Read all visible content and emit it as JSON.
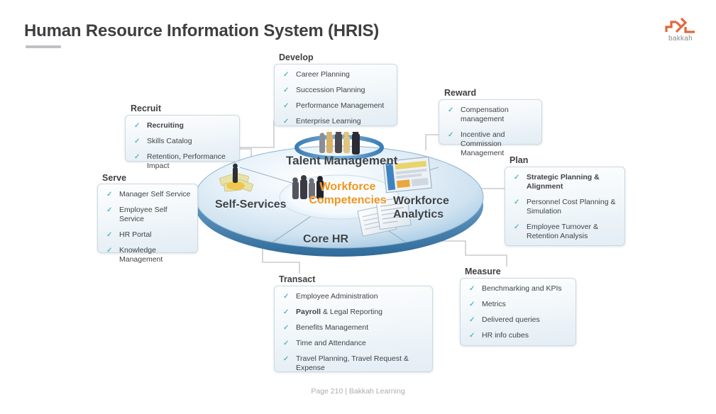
{
  "header": {
    "title": "Human Resource Information System (HRIS)"
  },
  "logo": {
    "wordmark": "bakkah",
    "icon": "bakkah-logo-icon",
    "color": "#e2683c"
  },
  "boxes": [
    {
      "id": "develop",
      "title": "Develop",
      "items": [
        {
          "text": "Career Planning",
          "bold": false
        },
        {
          "text": "Succession Planning",
          "bold": false
        },
        {
          "text": "Performance Management",
          "bold": false
        },
        {
          "text": "Enterprise Learning",
          "bold": false
        }
      ]
    },
    {
      "id": "recruit",
      "title": "Recruit",
      "items": [
        {
          "text": "Recruiting",
          "bold": true
        },
        {
          "text": "Skills Catalog",
          "bold": false
        },
        {
          "text": "Retention, Performance Impact",
          "bold": false
        }
      ]
    },
    {
      "id": "reward",
      "title": "Reward",
      "items": [
        {
          "text": "Compensation management",
          "bold": false
        },
        {
          "text": "Incentive and Commission Management",
          "bold": false
        }
      ]
    },
    {
      "id": "serve",
      "title": "Serve",
      "items": [
        {
          "text": "Manager Self Service",
          "bold": false
        },
        {
          "text": "Employee Self Service",
          "bold": false
        },
        {
          "text": "HR Portal",
          "bold": false
        },
        {
          "text": "Knowledge Management",
          "bold": false
        }
      ]
    },
    {
      "id": "plan",
      "title": "Plan",
      "items": [
        {
          "text": "Strategic Planning & Alignment",
          "bold": true
        },
        {
          "text": "Personnel Cost Planning & Simulation",
          "bold": false
        },
        {
          "text": "Employee Turnover & Retention Analysis",
          "bold": false
        }
      ]
    },
    {
      "id": "transact",
      "title": "Transact",
      "items": [
        {
          "text": "Employee Administration",
          "bold": false
        },
        {
          "text": "Payroll & Legal Reporting",
          "bold": false,
          "bold_prefix": "Payroll"
        },
        {
          "text": "Benefits Management",
          "bold": false
        },
        {
          "text": "Time and Attendance",
          "bold": false
        },
        {
          "text": "Travel Planning, Travel Request & Expense",
          "bold": false
        }
      ]
    },
    {
      "id": "measure",
      "title": "Measure",
      "items": [
        {
          "text": "Benchmarking and KPIs",
          "bold": false
        },
        {
          "text": "Metrics",
          "bold": false
        },
        {
          "text": "Delivered queries",
          "bold": false
        },
        {
          "text": "HR info cubes",
          "bold": false
        }
      ]
    }
  ],
  "disc": {
    "segments": {
      "talent": "Talent  Management",
      "self_services": "Self-Services",
      "workforce_analytics_line1": "Workforce",
      "workforce_analytics_line2": "Analytics",
      "core_hr": "Core HR"
    },
    "center_line1": "Workforce",
    "center_line2": "Competencies",
    "center_color": "#f0951e",
    "icons": [
      "people-group-icon",
      "money-cash-icon",
      "report-chart-icon",
      "documents-icon"
    ]
  },
  "footer": {
    "text": "Page 210  |  Bakkah Learning"
  },
  "checkmark": "✓"
}
